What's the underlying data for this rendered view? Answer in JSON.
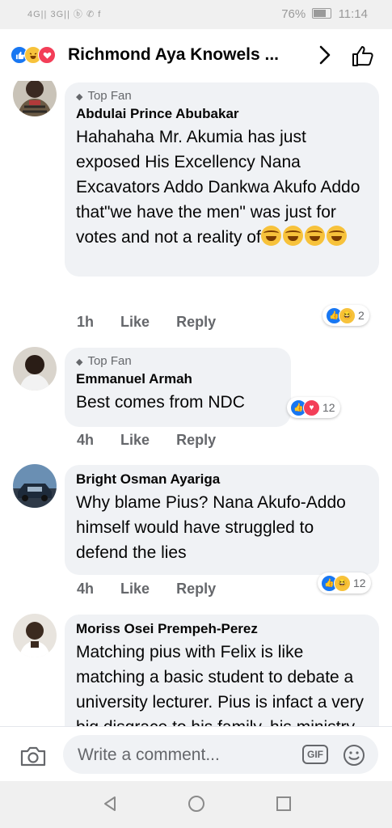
{
  "status": {
    "left": "4G|| 3G|| ⓑ ✆ f",
    "battery": "76%",
    "time": "11:14"
  },
  "header": {
    "title": "Richmond Aya Knowels ..."
  },
  "comments": [
    {
      "badge": "Top Fan",
      "name": "Abdulai Prince Abubakar",
      "text": "Hahahaha Mr. Akumia has just exposed His Excellency Nana Excavators Addo Dankwa Akufo Addo that\"we have the men\" was just for votes and not a reality of",
      "time": "1h",
      "like": "Like",
      "reply": "Reply",
      "reaction_count": "2"
    },
    {
      "badge": "Top Fan",
      "name": "Emmanuel Armah",
      "text": "Best comes from NDC",
      "time": "4h",
      "like": "Like",
      "reply": "Reply",
      "reaction_count": "12"
    },
    {
      "name": "Bright Osman Ayariga",
      "text": "Why blame Pius? Nana Akufo-Addo himself would have struggled to defend the lies",
      "time": "4h",
      "like": "Like",
      "reply": "Reply",
      "reaction_count": "12"
    },
    {
      "name": "Moriss Osei Prempeh-Perez",
      "text": "Matching pius with Felix is like matching a basic student to debate a university lecturer. Pius is infact a very big disgrace to his family, his ministry, the"
    }
  ],
  "composer": {
    "placeholder": "Write a comment...",
    "gif": "GIF"
  },
  "colors": {
    "like": "#1877f2",
    "haha": "#f7c23b",
    "love": "#f33e58",
    "bubble": "#f0f2f5"
  }
}
